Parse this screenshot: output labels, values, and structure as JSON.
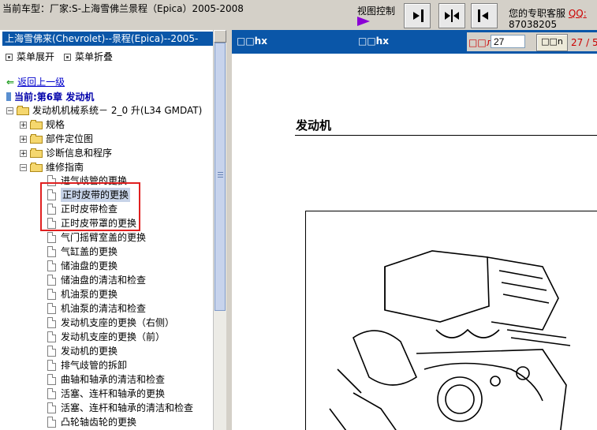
{
  "topbar": {
    "vehicle_text": "当前车型：厂家:S-上海雪佛兰景程（Epica）2005-2008",
    "view_control_label": "视图控制",
    "support_label": "您的专职客服",
    "qq_label": "QQ:",
    "phone": "87038205"
  },
  "left": {
    "title": "上海雪佛来(Chevrolet)--景程(Epica)--2005-",
    "expand_label": "菜单展开",
    "collapse_label": "菜单折叠",
    "back_label": "返回上一级",
    "current_label": "当前:第6章  发动机",
    "root_node": "发动机机械系统－  2_0 升(L34 GMDAT)",
    "folders": [
      "规格",
      "部件定位图",
      "诊断信息和程序",
      "维修指南"
    ],
    "items": [
      "进气歧管的更换",
      "正时皮带的更换",
      "正时皮带检查",
      "正时皮带罩的更换",
      "气门摇臂室盖的更换",
      "气缸盖的更换",
      "储油盘的更换",
      "储油盘的清洁和检查",
      "机油泵的更换",
      "机油泵的清洁和检查",
      "发动机支座的更换（右侧）",
      "发动机支座的更换（前）",
      "发动机的更换",
      "排气歧管的拆卸",
      "曲轴和轴承的清洁和检查",
      "活塞、连杆和轴承的更换",
      "活塞、连杆和轴承的清洁和检查",
      "凸轮轴齿轮的更换"
    ]
  },
  "right": {
    "header_tab1": "□□hx",
    "header_tab2": "□□hx",
    "page_label": "□□л",
    "page_value": "27",
    "go_button": "□□n",
    "page_count": "27 / 5",
    "heading": "发动机"
  }
}
